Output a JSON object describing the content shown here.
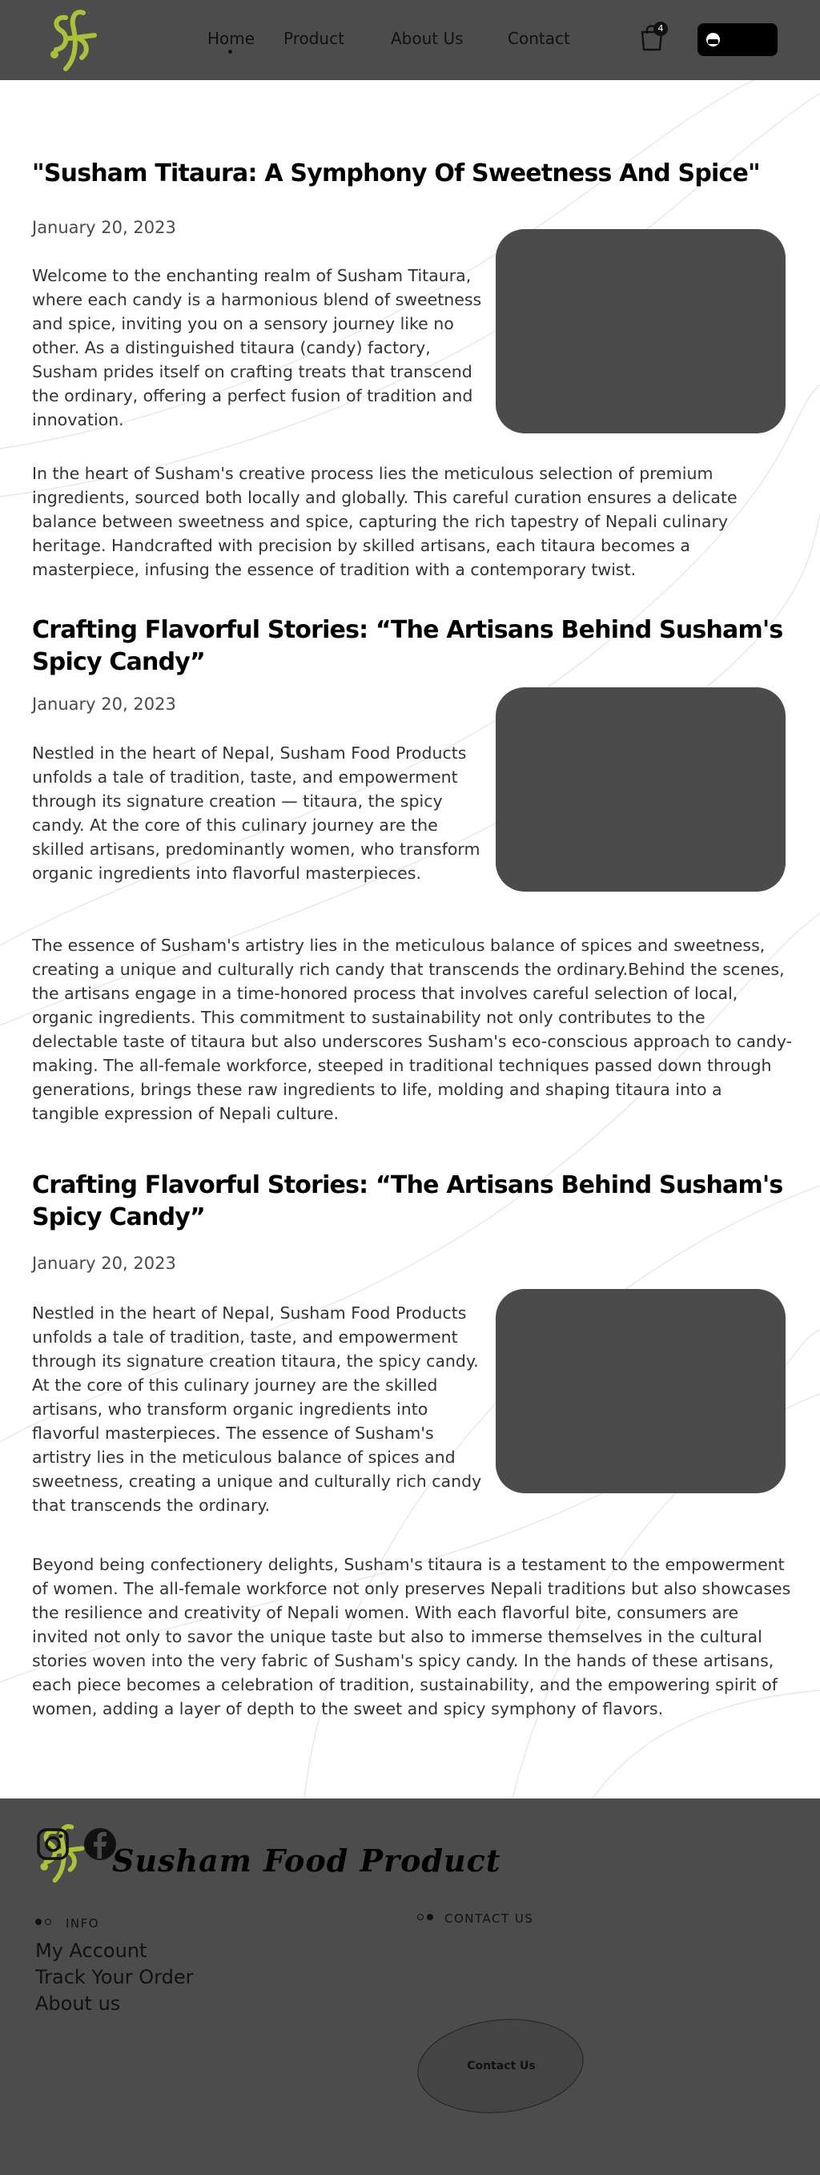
{
  "header": {
    "nav": [
      "Home",
      "Product",
      "About Us",
      "Contact"
    ],
    "cart_count": "4",
    "cart_icon": "shopping-bag-icon",
    "language_icon": "flag-icon"
  },
  "articles": [
    {
      "title": "\"Susham Titaura: A Symphony Of Sweetness And Spice\"",
      "date": "January 20, 2023",
      "intro": "Welcome to the enchanting realm of Susham Titaura, where each candy is a harmonious blend of sweetness and spice, inviting you on a sensory journey like no other. As a distinguished titaura (candy) factory, Susham prides itself on crafting treats that transcend the ordinary, offering a perfect fusion of tradition and innovation.",
      "body": "In the heart of Susham's creative process lies the meticulous selection of premium ingredients, sourced both locally and globally. This careful curation ensures a delicate balance between sweetness and spice, capturing the rich tapestry of Nepali culinary heritage. Handcrafted with precision by skilled artisans, each titaura becomes a masterpiece, infusing the essence of tradition with a contemporary twist."
    },
    {
      "title": "Crafting Flavorful Stories: “The Artisans Behind Susham's Spicy Candy”",
      "date": "January 20, 2023",
      "intro": "Nestled in the heart of Nepal, Susham Food Products unfolds a tale of tradition, taste, and empowerment through its signature creation — titaura, the spicy candy. At the core of this culinary journey are the skilled artisans, predominantly women, who transform organic ingredients into flavorful masterpieces.",
      "body": " The essence of Susham's artistry lies in the meticulous balance of spices and sweetness, creating a unique and culturally rich candy that transcends the ordinary.Behind the scenes, the artisans engage in a time-honored process that involves careful selection of local, organic ingredients. This commitment to sustainability not only contributes to the delectable taste of titaura but also underscores Susham's eco-conscious approach to candy-making. The all-female workforce, steeped in traditional techniques passed down through generations, brings these raw ingredients to life, molding and shaping titaura into a tangible expression of Nepali culture."
    },
    {
      "title": "Crafting Flavorful Stories: “The Artisans Behind Susham's Spicy Candy”",
      "date": "January 20, 2023",
      "intro": "Nestled in the heart of Nepal, Susham Food Products unfolds a tale of tradition, taste, and empowerment through its signature creation  titaura, the spicy candy. At the core of this culinary journey are the skilled artisans, who transform organic ingredients into flavorful masterpieces. The essence of Susham's artistry lies in the meticulous balance of spices and sweetness, creating a unique and culturally rich candy that transcends the ordinary.",
      "body": "Beyond being confectionery delights, Susham's titaura is a testament to the empowerment of women. The all-female workforce not only preserves Nepali traditions but also showcases the resilience and creativity of Nepali women. With each flavorful bite, consumers are invited not only to savor the unique taste but also to immerse themselves in the cultural stories woven into the very fabric of Susham's spicy candy. In the hands of these artisans, each piece becomes a celebration of tradition, sustainability, and the empowering spirit of women, adding a layer of depth to the sweet and spicy symphony of flavors."
    }
  ],
  "footer": {
    "brand": "Susham Food Product",
    "info_label": "INFO",
    "info_links": [
      "My Account",
      "Track Your Order",
      "About us"
    ],
    "contact_label": "CONTACT US",
    "contact_button": "Contact Us",
    "social_icons": [
      "instagram-icon",
      "facebook-icon"
    ]
  },
  "colors": {
    "header_bg": "#4c4c4c",
    "footer_bg": "#4c4c4c",
    "logo_green": "#a9c23a",
    "image_placeholder": "#4b4b4b"
  }
}
